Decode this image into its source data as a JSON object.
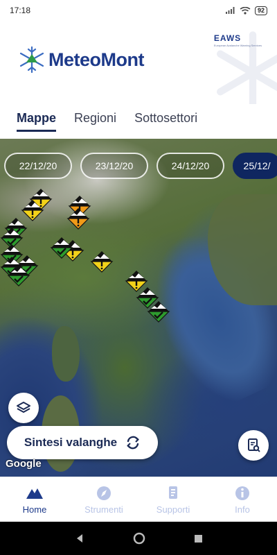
{
  "status_bar": {
    "time": "17:18",
    "battery": "92"
  },
  "brand": {
    "name": "MeteoMont",
    "partner": "EAWS",
    "partner_sub": "European Avalanche Warning Services"
  },
  "tabs": [
    {
      "label": "Mappe",
      "active": true
    },
    {
      "label": "Regioni",
      "active": false
    },
    {
      "label": "Sottosettori",
      "active": false
    }
  ],
  "dates": [
    {
      "label": "22/12/20",
      "active": false
    },
    {
      "label": "23/12/20",
      "active": false
    },
    {
      "label": "24/12/20",
      "active": false
    },
    {
      "label": "25/12/",
      "active": true
    }
  ],
  "map": {
    "danger_colors": {
      "level1": "#2e9b2e",
      "level2": "#f2d21a",
      "level3": "#f09a18"
    },
    "markers": [
      {
        "level": 2,
        "icon": "danger-level-2-icon"
      },
      {
        "level": 2,
        "icon": "danger-level-2-icon"
      },
      {
        "level": 3,
        "icon": "danger-level-3-icon"
      },
      {
        "level": 3,
        "icon": "danger-level-3-icon"
      },
      {
        "level": 1,
        "icon": "danger-level-1-icon"
      },
      {
        "level": 1,
        "icon": "danger-level-1-icon"
      },
      {
        "level": 1,
        "icon": "danger-level-1-icon"
      },
      {
        "level": 1,
        "icon": "danger-level-1-icon"
      },
      {
        "level": 1,
        "icon": "danger-level-1-icon"
      },
      {
        "level": 1,
        "icon": "danger-level-1-icon"
      },
      {
        "level": 2,
        "icon": "danger-level-2-icon"
      },
      {
        "level": 2,
        "icon": "danger-level-2-icon"
      },
      {
        "level": 2,
        "icon": "danger-level-2-icon"
      },
      {
        "level": 1,
        "icon": "danger-level-1-icon"
      },
      {
        "level": 1,
        "icon": "danger-level-1-icon"
      },
      {
        "level": 1,
        "icon": "danger-level-1-icon"
      }
    ],
    "attribution": "Google"
  },
  "actions": {
    "sintesi_label": "Sintesi valanghe"
  },
  "bottom_nav": [
    {
      "label": "Home",
      "icon": "mountain-icon",
      "active": true
    },
    {
      "label": "Strumenti",
      "icon": "compass-icon",
      "active": false
    },
    {
      "label": "Supporti",
      "icon": "document-icon",
      "active": false
    },
    {
      "label": "Info",
      "icon": "info-icon",
      "active": false
    }
  ]
}
